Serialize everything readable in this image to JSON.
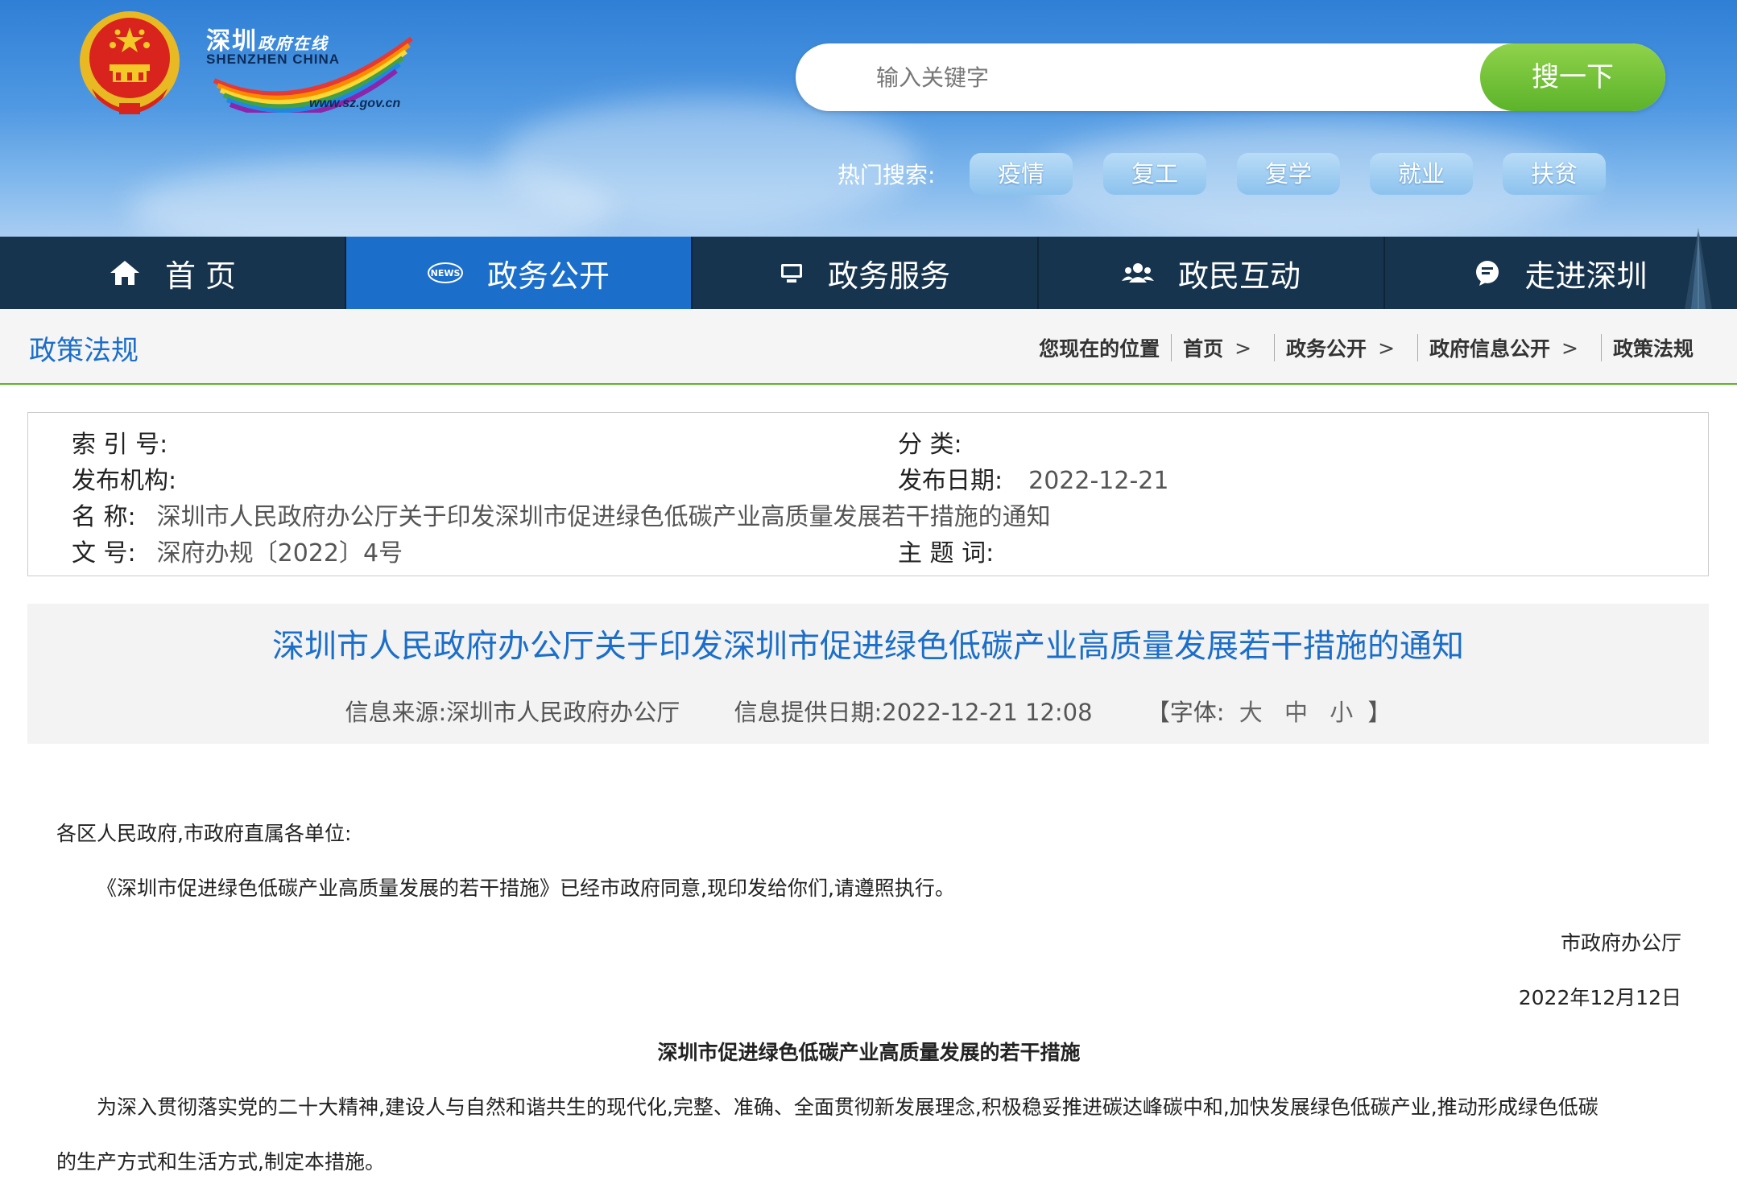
{
  "header": {
    "logo_title": "深圳",
    "logo_title_small": "政府在线",
    "logo_sub": "SHENZHEN CHINA",
    "logo_url": "www.sz.gov.cn",
    "search_placeholder": "输入关键字",
    "search_button": "搜一下",
    "hot_label": "热门搜索:",
    "hot_tags": [
      "疫情",
      "复工",
      "复学",
      "就业",
      "扶贫"
    ]
  },
  "nav": {
    "items": [
      {
        "label": "首 页",
        "icon": "home-icon"
      },
      {
        "label": "政务公开",
        "icon": "news-icon"
      },
      {
        "label": "政务服务",
        "icon": "monitor-icon"
      },
      {
        "label": "政民互动",
        "icon": "people-icon"
      },
      {
        "label": "走进深圳",
        "icon": "chat-icon"
      }
    ],
    "active_index": 1
  },
  "breadcrumb": {
    "section_title": "政策法规",
    "location_label": "您现在的位置",
    "items": [
      "首页",
      "政务公开",
      "政府信息公开",
      "政策法规"
    ],
    "separator": ">"
  },
  "meta": {
    "index_label": "索 引 号:",
    "index_value": "",
    "category_label": "分 类:",
    "category_value": "",
    "publisher_label": "发布机构:",
    "publisher_value": "",
    "date_label": "发布日期:",
    "date_value": "2022-12-21",
    "name_label": "名 称:",
    "name_value": "深圳市人民政府办公厅关于印发深圳市促进绿色低碳产业高质量发展若干措施的通知",
    "docno_label": "文 号:",
    "docno_value": "深府办规〔2022〕4号",
    "keywords_label": "主 题 词:",
    "keywords_value": ""
  },
  "document": {
    "title": "深圳市人民政府办公厅关于印发深圳市促进绿色低碳产业高质量发展若干措施的通知",
    "source": "信息来源:深圳市人民政府办公厅",
    "provided_date": "信息提供日期:2022-12-21 12:08",
    "font_open": "【字体:",
    "font_large": "大",
    "font_medium": "中",
    "font_small": "小",
    "font_close": "】",
    "salutation": "各区人民政府,市政府直属各单位:",
    "para1": "《深圳市促进绿色低碳产业高质量发展的若干措施》已经市政府同意,现印发给你们,请遵照执行。",
    "signer": "市政府办公厅",
    "sign_date": "2022年12月12日",
    "subtitle": "深圳市促进绿色低碳产业高质量发展的若干措施",
    "para2_line1": "为深入贯彻落实党的二十大精神,建设人与自然和谐共生的现代化,完整、准确、全面贯彻新发展理念,积极稳妥推进碳达峰碳中和,加快发展绿色低碳产业,推动形成绿色低碳",
    "para2_line2": "的生产方式和生活方式,制定本措施。"
  },
  "colors": {
    "nav_bg": "#17344e",
    "nav_active": "#1b6ec9",
    "title_blue": "#1b6ec9",
    "search_green": "#5cb32a",
    "divider_green": "#5cb32a"
  }
}
